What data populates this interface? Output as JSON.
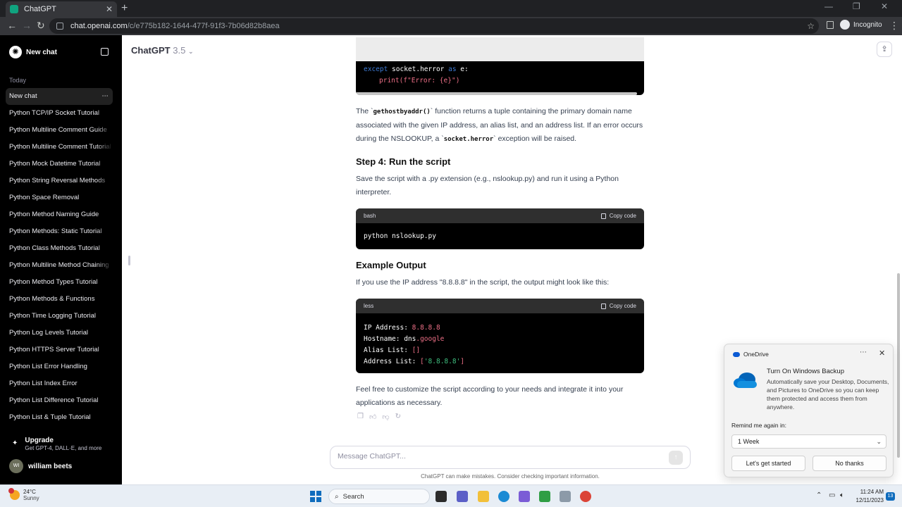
{
  "browser": {
    "tab_title": "ChatGPT",
    "url_host": "chat.openai.com",
    "url_path": "/c/e775b182-1644-477f-91f3-7b06d82b8aea",
    "incognito_label": "Incognito"
  },
  "sidebar": {
    "new_chat": "New chat",
    "section_today": "Today",
    "items": [
      {
        "label": "New chat",
        "active": true
      },
      {
        "label": "Python TCP/IP Socket Tutorial"
      },
      {
        "label": "Python Multiline Comment Guide"
      },
      {
        "label": "Python Multiline Comment Tutorial"
      },
      {
        "label": "Python Mock Datetime Tutorial"
      },
      {
        "label": "Python String Reversal Methods"
      },
      {
        "label": "Python Space Removal"
      },
      {
        "label": "Python Method Naming Guide"
      },
      {
        "label": "Python Methods: Static Tutorial"
      },
      {
        "label": "Python Class Methods Tutorial"
      },
      {
        "label": "Python Multiline Method Chaining"
      },
      {
        "label": "Python Method Types Tutorial"
      },
      {
        "label": "Python Methods & Functions"
      },
      {
        "label": "Python Time Logging Tutorial"
      },
      {
        "label": "Python Log Levels Tutorial"
      },
      {
        "label": "Python HTTPS Server Tutorial"
      },
      {
        "label": "Python List Error Handling"
      },
      {
        "label": "Python List Index Error"
      },
      {
        "label": "Python List Difference Tutorial"
      },
      {
        "label": "Python List & Tuple Tutorial"
      }
    ],
    "upgrade_title": "Upgrade",
    "upgrade_sub": "Get GPT-4, DALL·E, and more",
    "user_initials": "WI",
    "user_name": "william beets"
  },
  "header": {
    "model_name": "ChatGPT",
    "model_version": "3.5"
  },
  "content": {
    "code_top": {
      "except_kw": "except",
      "except_rest": " socket.herror ",
      "as_kw": "as",
      "e_var": " e:",
      "print_fn": "print(",
      "print_str": "f\"Error: {e}\"",
      "print_close": ")"
    },
    "para1": {
      "t1": "The `",
      "c1": "gethostbyaddr()",
      "t2": "` function returns a tuple containing the primary domain name associated with the given IP address, an alias list, and an address list. If an error occurs during the NSLOOKUP, a `",
      "c2": "socket.herror",
      "t3": "` exception will be raised."
    },
    "step4_heading": "Step 4: Run the script",
    "step4_text": "Save the script with a .py extension (e.g., nslookup.py) and run it using a Python interpreter.",
    "code_bash": {
      "lang": "bash",
      "copy": "Copy code",
      "line": "python nslookup.py"
    },
    "example_heading": "Example Output",
    "example_text": "If you use the IP address \"8.8.8.8\" in the script, the output might look like this:",
    "code_less": {
      "lang": "less",
      "copy": "Copy code",
      "l1_label": "IP Address: ",
      "l1_val": "8.8.8.8",
      "l2_label": "Hostname: dns",
      "l2_val": ".google",
      "l3_label": "Alias List: ",
      "l3_val": "[]",
      "l4_label": "Address List: ",
      "l4_open": "[",
      "l4_val": "'8.8.8.8'",
      "l4_close": "]"
    },
    "closing_text": "Feel free to customize the script according to your needs and integrate it into your applications as necessary."
  },
  "composer": {
    "placeholder": "Message ChatGPT...",
    "disclaimer": "ChatGPT can make mistakes. Consider checking important information."
  },
  "toast": {
    "app_name": "OneDrive",
    "title": "Turn On Windows Backup",
    "body": "Automatically save your Desktop, Documents, and Pictures to OneDrive so you can keep them protected and access them from anywhere.",
    "remind_label": "Remind me again in:",
    "remind_value": "1 Week",
    "primary_btn": "Let's get started",
    "secondary_btn": "No thanks"
  },
  "taskbar": {
    "temperature": "24°C",
    "condition": "Sunny",
    "weather_badge": "1",
    "search": "Search",
    "time": "11:24 AM",
    "date": "12/11/2023",
    "notifications": "13"
  },
  "colors": {
    "keyword": "#3e7bd6",
    "string": "#ec6f86",
    "sidebar_bg": "#000000"
  }
}
